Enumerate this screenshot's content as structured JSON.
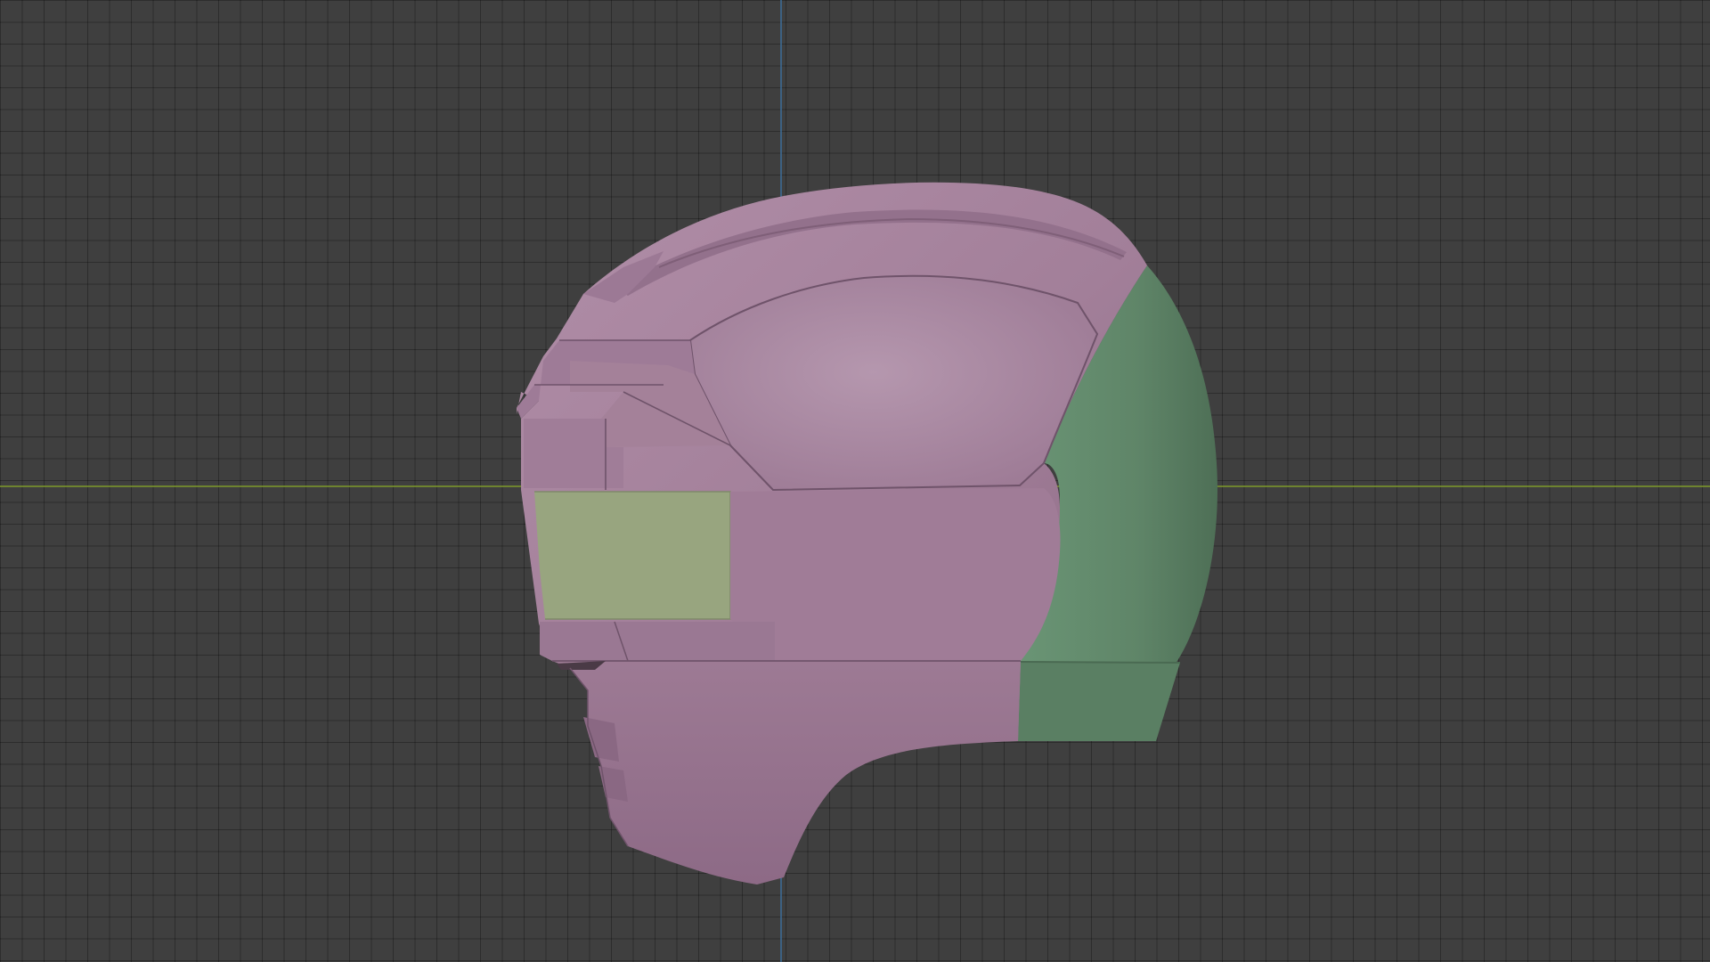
{
  "viewport": {
    "view": "side-orthographic",
    "background_color": "#3f3f3f",
    "grid_visible": true,
    "axis_colors": {
      "x_axis": "#7f9a2a",
      "z_axis": "#3d6e9a"
    }
  },
  "model": {
    "object": "helmet",
    "material_colors": {
      "shell": "#a27f99",
      "shell_dark": "#8c6984",
      "rear_panel": "#5f8568",
      "visor": "#98a57f"
    }
  }
}
